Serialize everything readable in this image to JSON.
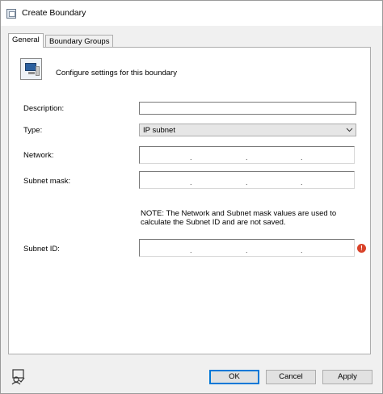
{
  "window": {
    "title": "Create Boundary"
  },
  "tabs": [
    {
      "label": "General"
    },
    {
      "label": "Boundary Groups"
    }
  ],
  "header": {
    "text": "Configure settings for this boundary"
  },
  "form": {
    "description": {
      "label": "Description:",
      "value": ""
    },
    "type": {
      "label": "Type:",
      "selected": "IP subnet"
    },
    "network": {
      "label": "Network:",
      "value": ". . ."
    },
    "subnet_mask": {
      "label": "Subnet mask:",
      "value": ". . ."
    },
    "note": "NOTE: The Network and Subnet mask values are used to calculate the Subnet ID and are not saved.",
    "subnet_id": {
      "label": "Subnet ID:",
      "value": ". . ."
    }
  },
  "buttons": {
    "ok": "OK",
    "cancel": "Cancel",
    "apply": "Apply"
  },
  "colors": {
    "accent": "#0078d7",
    "error": "#d9432a"
  },
  "icons": {
    "title": "dialog-icon",
    "header": "computer-icon",
    "error": "error-icon",
    "footer": "user-help-icon"
  }
}
